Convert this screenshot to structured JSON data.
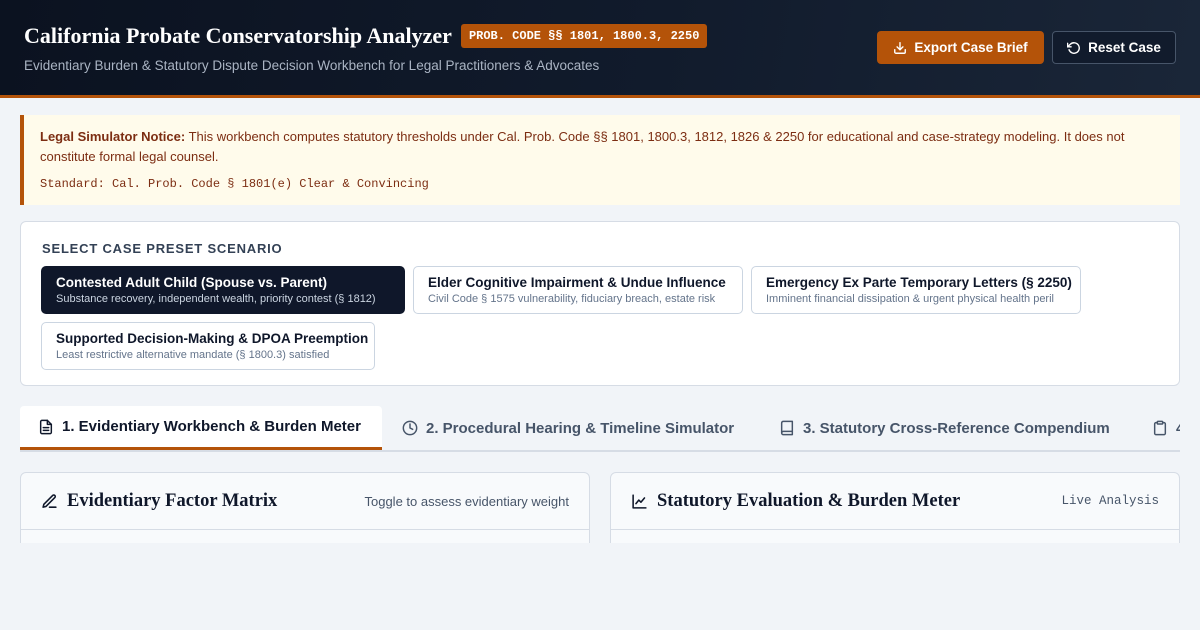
{
  "header": {
    "title": "California Probate Conservatorship Analyzer",
    "code_badge": "PROB. CODE §§ 1801, 1800.3, 2250",
    "subtitle": "Evidentiary Burden & Statutory Dispute Decision Workbench for Legal Practitioners & Advocates",
    "export_label": "Export Case Brief",
    "reset_label": "Reset Case"
  },
  "notice": {
    "label": "Legal Simulator Notice:",
    "text": "This workbench computes statutory thresholds under Cal. Prob. Code §§ 1801, 1800.3, 1812, 1826 & 2250 for educational and case-strategy modeling. It does not constitute formal legal counsel.",
    "standard": "Standard: Cal. Prob. Code § 1801(e) Clear & Convincing"
  },
  "presets": {
    "heading": "SELECT CASE PRESET SCENARIO",
    "items": [
      {
        "title": "Contested Adult Child (Spouse vs. Parent)",
        "subtitle": "Substance recovery, independent wealth, priority contest (§ 1812)"
      },
      {
        "title": "Elder Cognitive Impairment & Undue Influence",
        "subtitle": "Civil Code § 1575 vulnerability, fiduciary breach, estate risk"
      },
      {
        "title": "Emergency Ex Parte Temporary Letters (§ 2250)",
        "subtitle": "Imminent financial dissipation & urgent physical health peril"
      },
      {
        "title": "Supported Decision-Making & DPOA Preemption",
        "subtitle": "Least restrictive alternative mandate (§ 1800.3) satisfied"
      }
    ]
  },
  "tabs": [
    {
      "label": "1. Evidentiary Workbench & Burden Meter"
    },
    {
      "label": "2. Procedural Hearing & Timeline Simulator"
    },
    {
      "label": "3. Statutory Cross-Reference Compendium"
    },
    {
      "label": "4"
    }
  ],
  "cards": {
    "left_title": "Evidentiary Factor Matrix",
    "left_meta": "Toggle to assess evidentiary weight",
    "right_title": "Statutory Evaluation & Burden Meter",
    "right_meta": "Live Analysis"
  },
  "colors": {
    "accent": "#b45309",
    "header_bg": "#0b1220",
    "notice_bg": "#fffbeb",
    "notice_text": "#7c2d12",
    "active_preset": "#0f172a"
  },
  "icons": {
    "export": "download-icon",
    "reset": "rotate-ccw-icon",
    "tab1": "file-text-icon",
    "tab2": "clock-icon",
    "tab3": "book-icon",
    "tab4": "clipboard-icon",
    "left_card": "pencil-icon",
    "right_card": "line-chart-icon"
  }
}
